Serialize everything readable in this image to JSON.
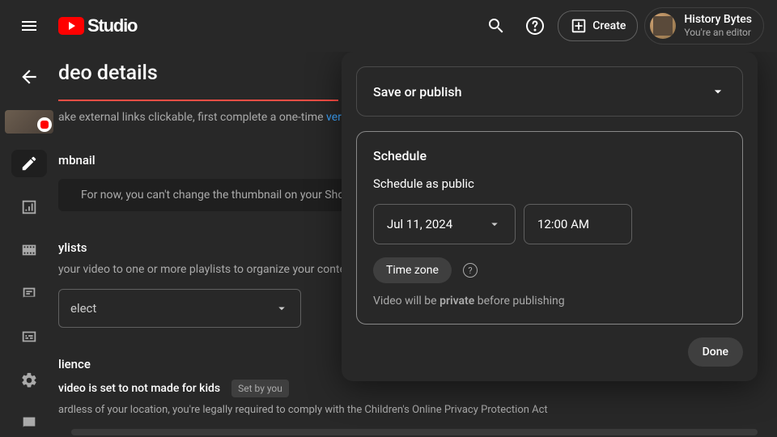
{
  "header": {
    "brand": "Studio",
    "create_label": "Create",
    "account_name": "History Bytes",
    "account_role": "You're an editor"
  },
  "page": {
    "title_fragment": "deo details",
    "hint_prefix": "ake external links clickable, first complete a one-time ",
    "hint_link": "verifica",
    "thumb_heading": "mbnail",
    "thumb_note": "For now, you can't change the thumbnail on your Short",
    "playlist_heading": "ylists",
    "playlist_hint": " your video to one or more playlists to organize your conten",
    "select_placeholder": "elect",
    "audience_heading": "lience",
    "audience_main": " video is set to not made for kids",
    "audience_chip": "Set by you",
    "audience_sub": "ardless of your location, you're legally required to comply with the Children's Online Privacy Protection Act"
  },
  "panel": {
    "save_publish": "Save or publish",
    "schedule_title": "Schedule",
    "schedule_sub": "Schedule as public",
    "date_value": "Jul 11, 2024",
    "time_value": "12:00 AM",
    "timezone_label": "Time zone",
    "note_prefix": "Video will be ",
    "note_bold": "private",
    "note_suffix": " before publishing",
    "done_label": "Done"
  }
}
